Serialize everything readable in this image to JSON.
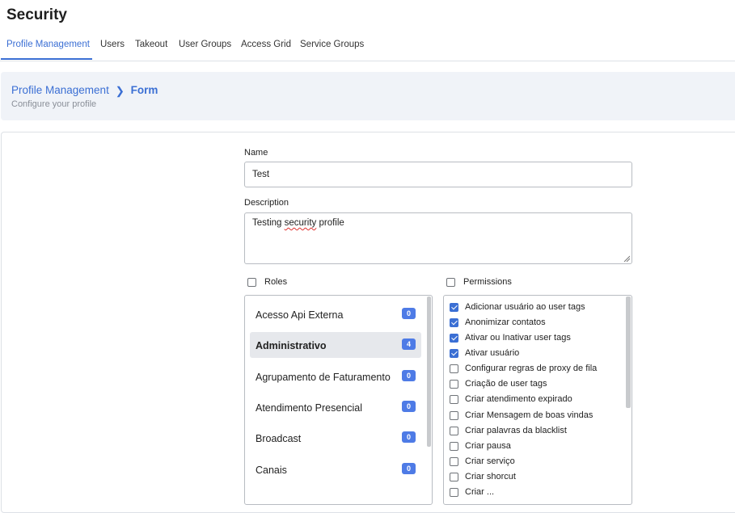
{
  "page": {
    "title": "Security"
  },
  "tabs": [
    {
      "label": "Profile Management",
      "active": true
    },
    {
      "label": "Users"
    },
    {
      "label": "Takeout"
    },
    {
      "label": "User Groups"
    },
    {
      "label": "Access Grid"
    },
    {
      "label": "Service Groups"
    }
  ],
  "breadcrumb": {
    "parent": "Profile Management",
    "separator": "❯",
    "current": "Form"
  },
  "subtitle": "Configure your profile",
  "form": {
    "name_label": "Name",
    "name_value": "Test",
    "description_label": "Description",
    "description_value_word1": "Testing",
    "description_value_word2": "security",
    "description_value_word3": "profile",
    "roles_label": "Roles",
    "permissions_label": "Permissions"
  },
  "roles": [
    {
      "name": "Acesso Api Externa",
      "count": "0"
    },
    {
      "name": "Administrativo",
      "count": "4",
      "selected": true
    },
    {
      "name": "Agrupamento de Faturamento",
      "count": "0"
    },
    {
      "name": "Atendimento Presencial",
      "count": "0"
    },
    {
      "name": "Broadcast",
      "count": "0"
    },
    {
      "name": "Canais",
      "count": "0"
    }
  ],
  "permissions": [
    {
      "label": "Adicionar usuário ao user tags",
      "checked": true
    },
    {
      "label": "Anonimizar contatos",
      "checked": true
    },
    {
      "label": "Ativar ou Inativar user tags",
      "checked": true
    },
    {
      "label": "Ativar usuário",
      "checked": true
    },
    {
      "label": "Configurar regras de proxy de fila",
      "checked": false
    },
    {
      "label": "Criação de user tags",
      "checked": false
    },
    {
      "label": "Criar atendimento expirado",
      "checked": false
    },
    {
      "label": "Criar Mensagem de boas vindas",
      "checked": false
    },
    {
      "label": "Criar palavras da blacklist",
      "checked": false
    },
    {
      "label": "Criar pausa",
      "checked": false
    },
    {
      "label": "Criar serviço",
      "checked": false
    },
    {
      "label": "Criar shorcut",
      "checked": false
    },
    {
      "label": "Criar ...",
      "checked": false
    }
  ],
  "colors": {
    "accent": "#3b6fd4",
    "badge": "#4e7be6",
    "hero_bg": "#f0f3f8"
  }
}
